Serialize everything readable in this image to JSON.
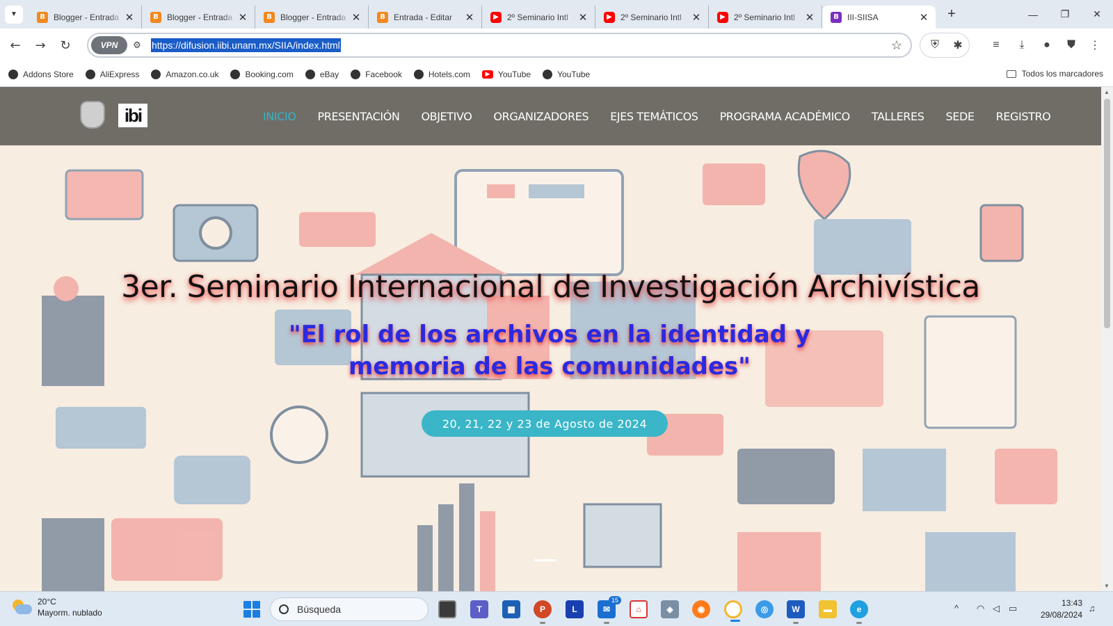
{
  "tabs": [
    {
      "label": "Blogger - Entrada",
      "icon": "blogger-icon",
      "icon_glyph": "B"
    },
    {
      "label": "Blogger - Entrada",
      "icon": "blogger-icon",
      "icon_glyph": "B"
    },
    {
      "label": "Blogger - Entrada",
      "icon": "blogger-icon",
      "icon_glyph": "B"
    },
    {
      "label": "Entrada - Editar",
      "icon": "blogger-icon",
      "icon_glyph": "B"
    },
    {
      "label": "2º Seminario Intl",
      "icon": "youtube-icon",
      "icon_glyph": "▶"
    },
    {
      "label": "2º Seminario Intl",
      "icon": "youtube-icon",
      "icon_glyph": "▶"
    },
    {
      "label": "2º Seminario Intl",
      "icon": "youtube-icon",
      "icon_glyph": "▶"
    },
    {
      "label": "III-SIISA",
      "icon": "bootstrap-icon",
      "icon_glyph": "B",
      "active": true
    }
  ],
  "address": {
    "vpn_label": "VPN",
    "url": "https://difusion.iibi.unam.mx/SIIA/index.html"
  },
  "bookmarks": [
    {
      "label": "Addons Store"
    },
    {
      "label": "AliExpress"
    },
    {
      "label": "Amazon.co.uk"
    },
    {
      "label": "Booking.com"
    },
    {
      "label": "eBay"
    },
    {
      "label": "Facebook"
    },
    {
      "label": "Hotels.com"
    },
    {
      "label": "YouTube",
      "youtube": true
    },
    {
      "label": "YouTube"
    }
  ],
  "all_bookmarks": "Todos los marcadores",
  "site": {
    "logo_iibi": "ibi",
    "menu": [
      "INICIO",
      "PRESENTACIÓN",
      "OBJETIVO",
      "ORGANIZADORES",
      "EJES TEMÁTICOS",
      "PROGRAMA ACADÉMICO",
      "TALLERES",
      "SEDE",
      "REGISTRO"
    ],
    "active_menu": "INICIO",
    "hero_title": "3er. Seminario Internacional de Investigación Archivística",
    "hero_subtitle_line1": "\"El rol de los archivos en la identidad y",
    "hero_subtitle_line2": "memoria de las comunidades\"",
    "date": "20, 21, 22 y 23 de Agosto de 2024"
  },
  "colors": {
    "accent": "#33b3c8",
    "subtitle": "#2a2ae0",
    "url_highlight": "#1a5cc8"
  },
  "taskbar": {
    "weather_temp": "20°C",
    "weather_desc": "Mayorm. nublado",
    "search_placeholder": "Búsqueda",
    "mail_badge": "15",
    "time": "13:43",
    "date": "29/08/2024"
  }
}
